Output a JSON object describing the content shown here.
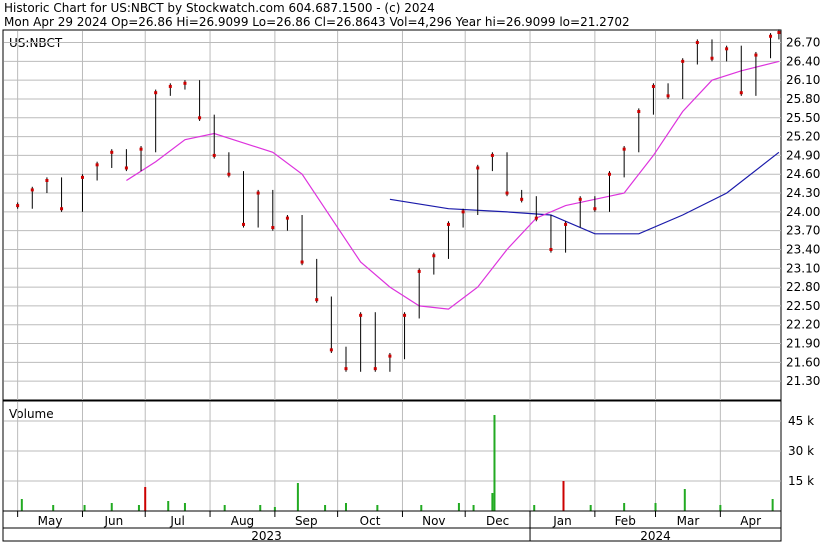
{
  "header": {
    "line1": "Historic Chart for US:NBCT by Stockwatch.com 604.687.1500 - (c) 2024",
    "line2": "Mon Apr 29 2024   Op=26.86   Hi=26.9099   Lo=26.86   Cl=26.8643   Vol=4,296   Year hi=26.9099   lo=21.2702"
  },
  "colors": {
    "candle": "#cc0000",
    "ma_short": "#dd33dd",
    "ma_long": "#1a1aaa",
    "volume": "#22aa22",
    "volume_down": "#cc0000",
    "grid": "#bbbbbb"
  },
  "chart_data": [
    {
      "type": "line",
      "symbol_label": "US:NBCT",
      "ylim": [
        21.0,
        26.9
      ],
      "y_ticks": [
        "26.70",
        "26.40",
        "26.10",
        "25.80",
        "25.50",
        "25.20",
        "24.90",
        "24.60",
        "24.30",
        "24.00",
        "23.70",
        "23.40",
        "23.10",
        "22.80",
        "22.50",
        "22.20",
        "21.90",
        "21.60",
        "21.30"
      ],
      "x_months": [
        "May",
        "Jun",
        "Jul",
        "Aug",
        "Sep",
        "Oct",
        "Nov",
        "Dec",
        "Jan",
        "Feb",
        "Mar",
        "Apr"
      ],
      "x_years": [
        "2023",
        "2024"
      ],
      "price": [
        [
          "2023-05-01",
          24.1
        ],
        [
          "2023-05-08",
          24.35
        ],
        [
          "2023-05-15",
          24.5
        ],
        [
          "2023-05-22",
          24.05
        ],
        [
          "2023-06-01",
          24.55
        ],
        [
          "2023-06-08",
          24.75
        ],
        [
          "2023-06-15",
          24.95
        ],
        [
          "2023-06-22",
          24.7
        ],
        [
          "2023-06-29",
          25.0
        ],
        [
          "2023-07-06",
          25.9
        ],
        [
          "2023-07-13",
          26.0
        ],
        [
          "2023-07-20",
          26.05
        ],
        [
          "2023-07-27",
          25.5
        ],
        [
          "2023-08-03",
          24.9
        ],
        [
          "2023-08-10",
          24.6
        ],
        [
          "2023-08-17",
          23.8
        ],
        [
          "2023-08-24",
          24.3
        ],
        [
          "2023-08-31",
          23.75
        ],
        [
          "2023-09-07",
          23.9
        ],
        [
          "2023-09-14",
          23.2
        ],
        [
          "2023-09-21",
          22.6
        ],
        [
          "2023-09-28",
          21.8
        ],
        [
          "2023-10-05",
          21.5
        ],
        [
          "2023-10-12",
          22.35
        ],
        [
          "2023-10-19",
          21.5
        ],
        [
          "2023-10-26",
          21.7
        ],
        [
          "2023-11-02",
          22.35
        ],
        [
          "2023-11-09",
          23.05
        ],
        [
          "2023-11-16",
          23.3
        ],
        [
          "2023-11-23",
          23.8
        ],
        [
          "2023-11-30",
          24.0
        ],
        [
          "2023-12-07",
          24.7
        ],
        [
          "2023-12-14",
          24.9
        ],
        [
          "2023-12-21",
          24.3
        ],
        [
          "2023-12-28",
          24.2
        ],
        [
          "2024-01-04",
          23.9
        ],
        [
          "2024-01-11",
          23.4
        ],
        [
          "2024-01-18",
          23.8
        ],
        [
          "2024-01-25",
          24.2
        ],
        [
          "2024-02-01",
          24.05
        ],
        [
          "2024-02-08",
          24.6
        ],
        [
          "2024-02-15",
          25.0
        ],
        [
          "2024-02-22",
          25.6
        ],
        [
          "2024-02-29",
          26.0
        ],
        [
          "2024-03-07",
          25.85
        ],
        [
          "2024-03-14",
          26.4
        ],
        [
          "2024-03-21",
          26.7
        ],
        [
          "2024-03-28",
          26.45
        ],
        [
          "2024-04-04",
          26.6
        ],
        [
          "2024-04-11",
          25.9
        ],
        [
          "2024-04-18",
          26.5
        ],
        [
          "2024-04-25",
          26.8
        ],
        [
          "2024-04-29",
          26.86
        ]
      ],
      "ma_short": [
        [
          "2023-06-22",
          24.5
        ],
        [
          "2023-07-06",
          24.8
        ],
        [
          "2023-07-20",
          25.15
        ],
        [
          "2023-08-03",
          25.25
        ],
        [
          "2023-08-17",
          25.1
        ],
        [
          "2023-08-31",
          24.95
        ],
        [
          "2023-09-14",
          24.6
        ],
        [
          "2023-09-28",
          23.9
        ],
        [
          "2023-10-12",
          23.2
        ],
        [
          "2023-10-26",
          22.8
        ],
        [
          "2023-11-09",
          22.5
        ],
        [
          "2023-11-23",
          22.45
        ],
        [
          "2023-12-07",
          22.8
        ],
        [
          "2023-12-21",
          23.4
        ],
        [
          "2024-01-04",
          23.9
        ],
        [
          "2024-01-18",
          24.1
        ],
        [
          "2024-02-01",
          24.2
        ],
        [
          "2024-02-15",
          24.3
        ],
        [
          "2024-02-29",
          24.9
        ],
        [
          "2024-03-14",
          25.6
        ],
        [
          "2024-03-28",
          26.1
        ],
        [
          "2024-04-11",
          26.25
        ],
        [
          "2024-04-29",
          26.4
        ]
      ],
      "ma_long": [
        [
          "2023-10-26",
          24.2
        ],
        [
          "2023-11-23",
          24.05
        ],
        [
          "2023-12-21",
          24.0
        ],
        [
          "2024-01-11",
          23.95
        ],
        [
          "2024-02-01",
          23.65
        ],
        [
          "2024-02-22",
          23.65
        ],
        [
          "2024-03-14",
          23.95
        ],
        [
          "2024-04-04",
          24.3
        ],
        [
          "2024-04-29",
          24.95
        ]
      ]
    },
    {
      "type": "bar",
      "title": "Volume",
      "ylim": [
        0,
        55
      ],
      "y_ticks": [
        "45 k",
        "30 k",
        "15 k"
      ],
      "unit": "k shares",
      "values": [
        [
          "2023-05-03",
          6
        ],
        [
          "2023-05-18",
          3
        ],
        [
          "2023-06-02",
          3
        ],
        [
          "2023-06-15",
          4
        ],
        [
          "2023-06-28",
          3
        ],
        [
          "2023-07-01",
          12
        ],
        [
          "2023-07-12",
          5
        ],
        [
          "2023-07-20",
          4
        ],
        [
          "2023-08-08",
          3
        ],
        [
          "2023-08-25",
          3
        ],
        [
          "2023-09-01",
          2
        ],
        [
          "2023-09-12",
          14
        ],
        [
          "2023-09-25",
          3
        ],
        [
          "2023-10-05",
          4
        ],
        [
          "2023-10-20",
          3
        ],
        [
          "2023-11-10",
          3
        ],
        [
          "2023-11-28",
          4
        ],
        [
          "2023-12-05",
          3
        ],
        [
          "2023-12-15",
          48
        ],
        [
          "2023-12-14",
          9
        ],
        [
          "2024-01-03",
          3
        ],
        [
          "2024-01-17",
          15
        ],
        [
          "2024-01-30",
          3
        ],
        [
          "2024-02-15",
          4
        ],
        [
          "2024-03-01",
          4
        ],
        [
          "2024-03-15",
          11
        ],
        [
          "2024-04-01",
          3
        ],
        [
          "2024-04-26",
          6
        ]
      ]
    }
  ]
}
